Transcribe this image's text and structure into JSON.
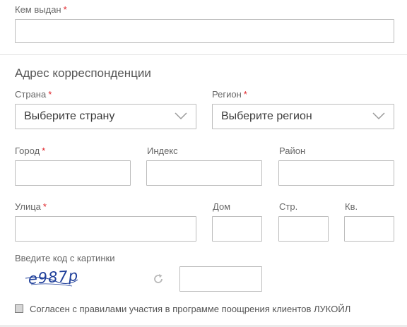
{
  "issued_by": {
    "label": "Кем выдан",
    "required": "*",
    "value": ""
  },
  "correspondence": {
    "title": "Адрес корреспонденции",
    "country": {
      "label": "Страна",
      "required": "*",
      "selected": "Выберите страну"
    },
    "region": {
      "label": "Регион",
      "required": "*",
      "selected": "Выберите регион"
    },
    "city": {
      "label": "Город",
      "required": "*",
      "value": ""
    },
    "postcode": {
      "label": "Индекс",
      "value": ""
    },
    "district": {
      "label": "Район",
      "value": ""
    },
    "street": {
      "label": "Улица",
      "required": "*",
      "value": ""
    },
    "house": {
      "label": "Дом",
      "value": ""
    },
    "building": {
      "label": "Стр.",
      "value": ""
    },
    "apartment": {
      "label": "Кв.",
      "value": ""
    }
  },
  "captcha": {
    "label": "Введите код с картинки",
    "image_text": "e987p",
    "value": "",
    "refresh_icon": "refresh-icon"
  },
  "consent": {
    "checked": false,
    "label": "Согласен с правилами участия в программе поощрения клиентов ЛУКОЙЛ"
  },
  "colors": {
    "required_mark": "#e0242a",
    "field_border": "#bcbcbc",
    "captcha_text": "#1f3f9a"
  }
}
